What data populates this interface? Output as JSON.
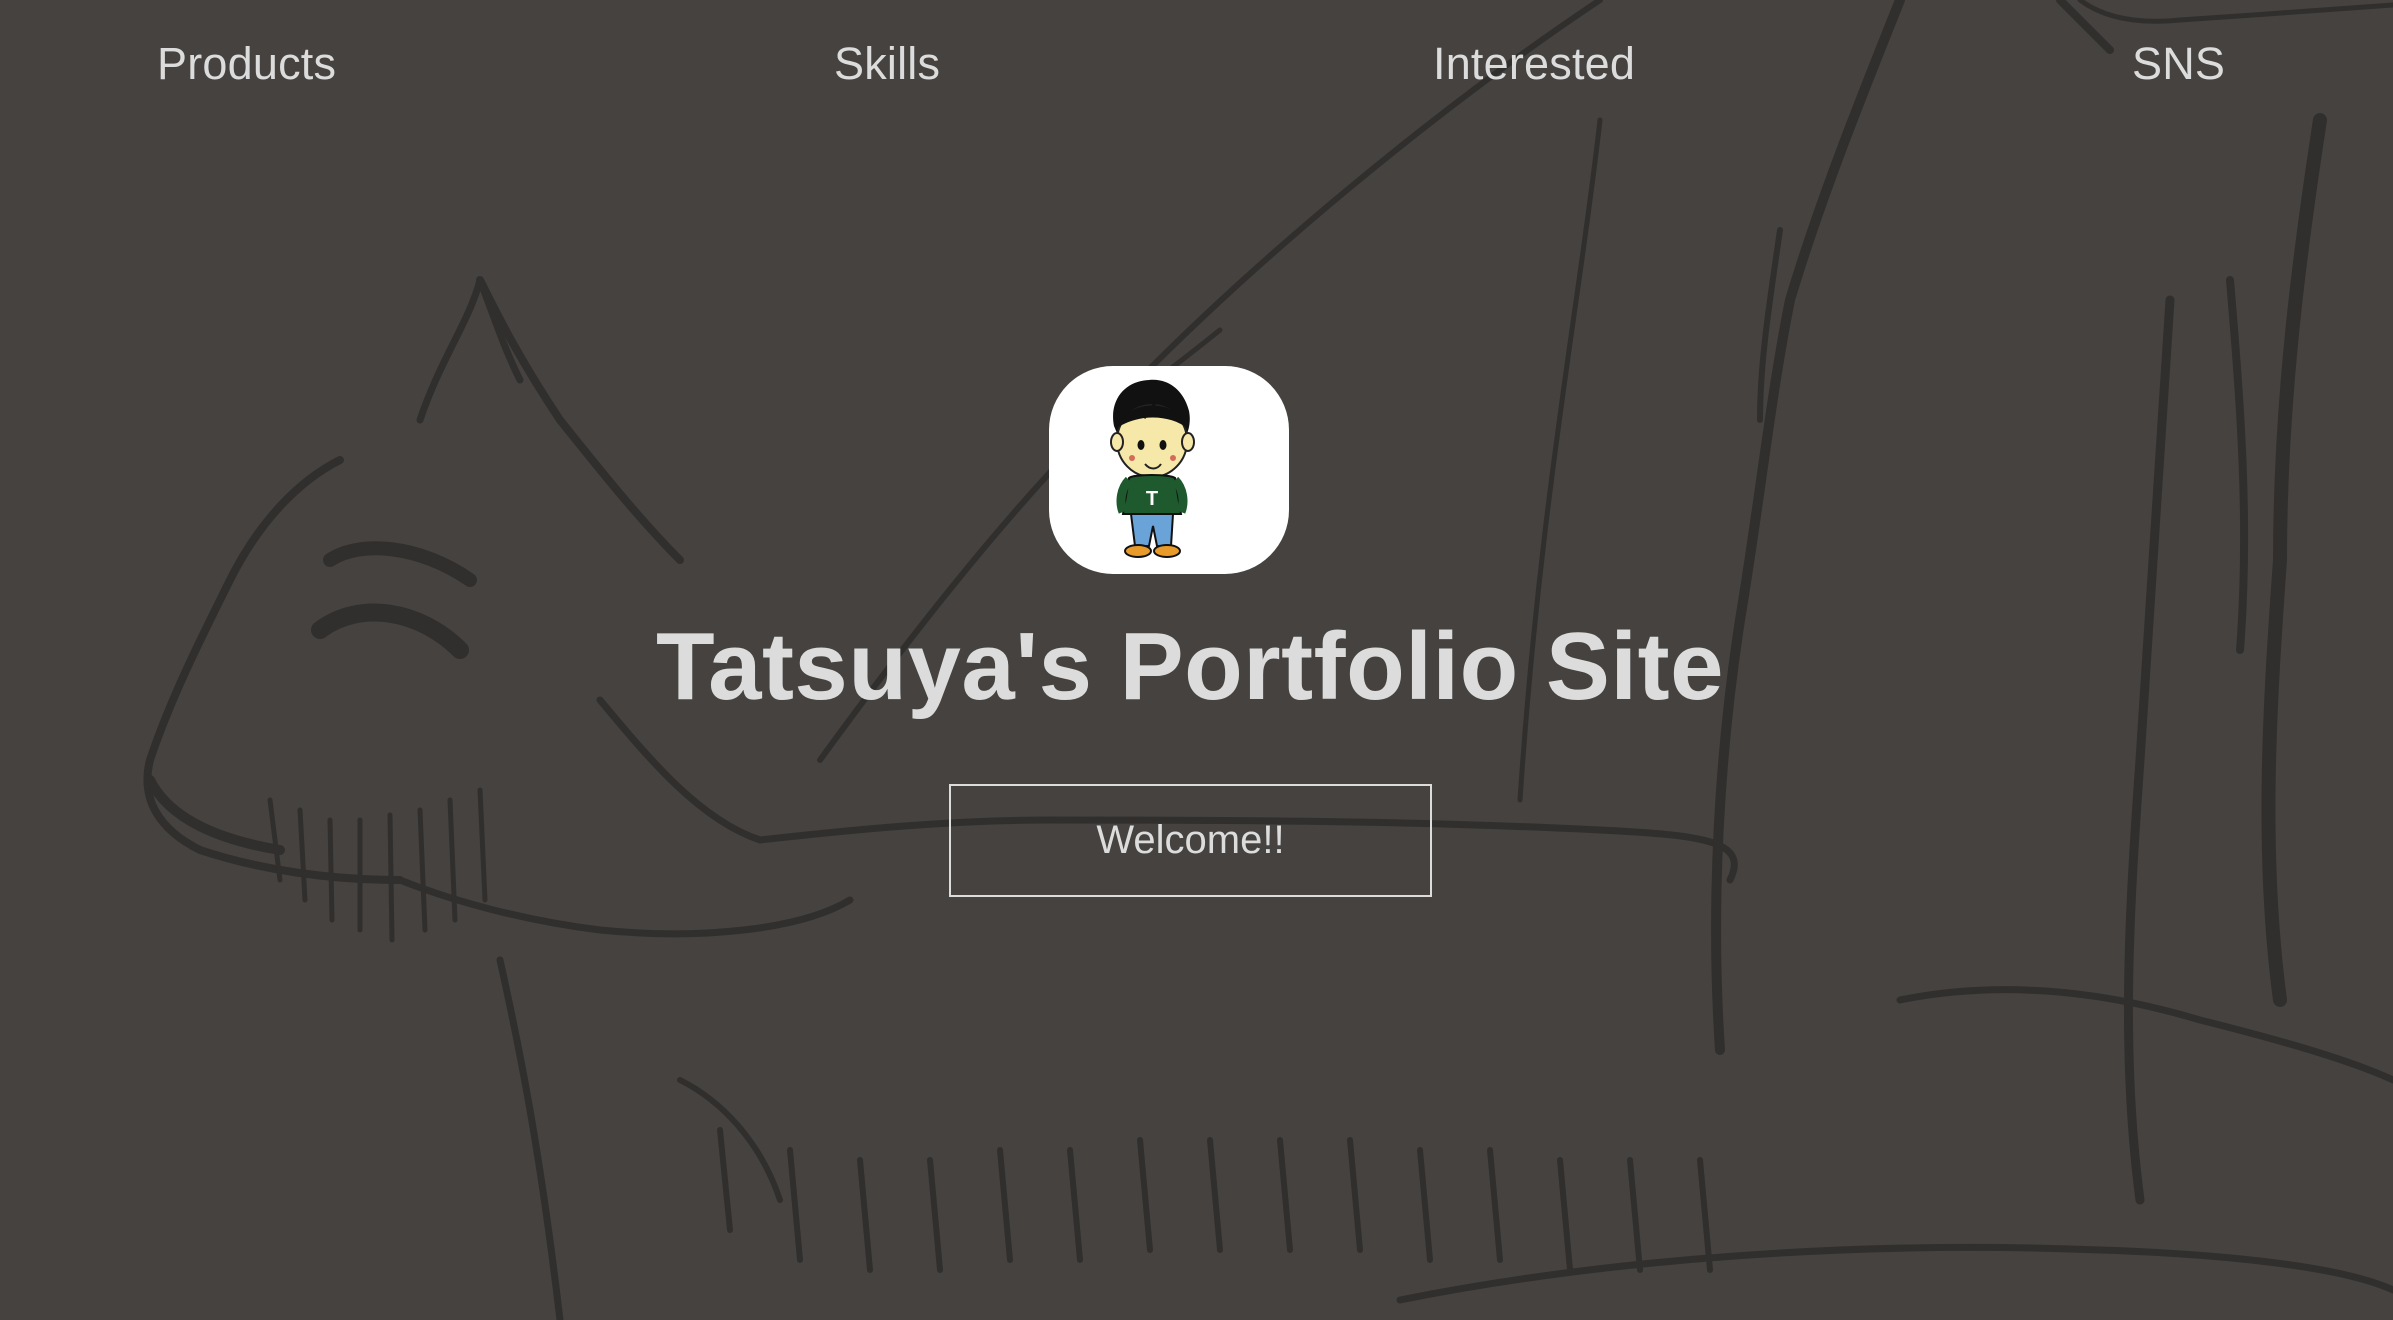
{
  "nav": {
    "items": [
      {
        "label": "Products"
      },
      {
        "label": "Skills"
      },
      {
        "label": "Interested"
      },
      {
        "label": "SNS"
      }
    ]
  },
  "hero": {
    "title": "Tatsuya's Portfolio Site",
    "welcome_label": "Welcome!!",
    "avatar_icon": "boy-character-avatar-icon",
    "avatar_shirt_letter": "T"
  },
  "colors": {
    "background": "#45423f",
    "text": "#dcdcdc",
    "avatar_bg": "#ffffff",
    "shirt": "#1f5a2e",
    "pants": "#6aa3d8",
    "shoes": "#e89a2a"
  },
  "background_icon": "pencil-sketch-goat-drawing"
}
